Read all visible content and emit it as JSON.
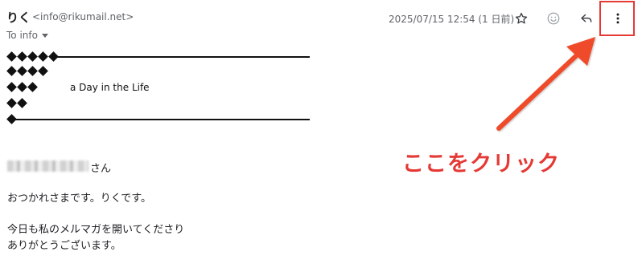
{
  "header": {
    "sender_name": "りく",
    "sender_email": "<info@rikumail.net>",
    "recipient": "To info",
    "date": "2025/07/15 12:54 (1 日前)"
  },
  "newsletter": {
    "title": "a Day in the Life"
  },
  "body": {
    "honorific": "さん",
    "greeting": "おつかれさまです。りくです。",
    "thanks_line_1": "今日も私のメルマガを開いてくださり",
    "thanks_line_2": "ありがとうございます。"
  },
  "annotation": {
    "callout": "ここをクリック",
    "color": "#e53935"
  },
  "icons": {
    "star": "star-icon",
    "emoji": "emoji-icon",
    "reply": "reply-icon",
    "more": "more-vertical-icon"
  }
}
